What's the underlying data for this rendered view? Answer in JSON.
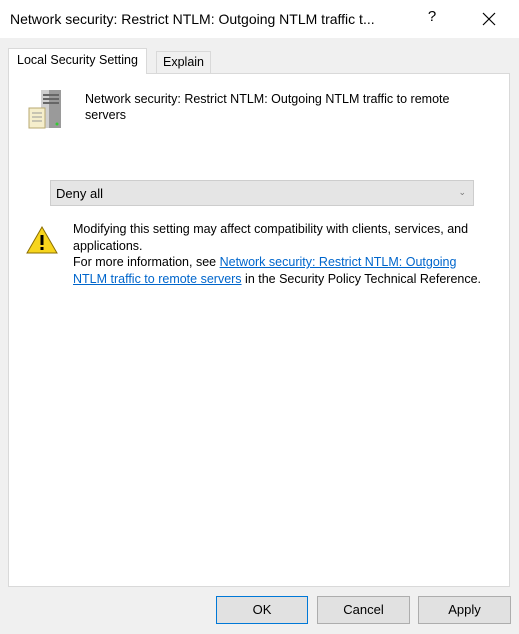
{
  "window": {
    "title": "Network security: Restrict NTLM: Outgoing NTLM traffic t...",
    "help": "?"
  },
  "tabs": [
    {
      "label": "Local Security Setting",
      "active": true
    },
    {
      "label": "Explain",
      "active": false
    }
  ],
  "policy": {
    "icon": "server-policy-icon",
    "title": "Network security: Restrict NTLM: Outgoing NTLM traffic to remote servers"
  },
  "dropdown": {
    "selected": "Deny all"
  },
  "warning": {
    "icon": "warning-icon",
    "line1": "Modifying this setting may affect compatibility with clients, services, and applications.",
    "line2_prefix": "For more information, see ",
    "link": "Network security: Restrict NTLM: Outgoing NTLM traffic to remote servers",
    "line2_suffix": " in the Security Policy Technical Reference."
  },
  "buttons": {
    "ok": "OK",
    "cancel": "Cancel",
    "apply": "Apply"
  },
  "colors": {
    "link": "#0066cc",
    "focus": "#0078d7"
  }
}
